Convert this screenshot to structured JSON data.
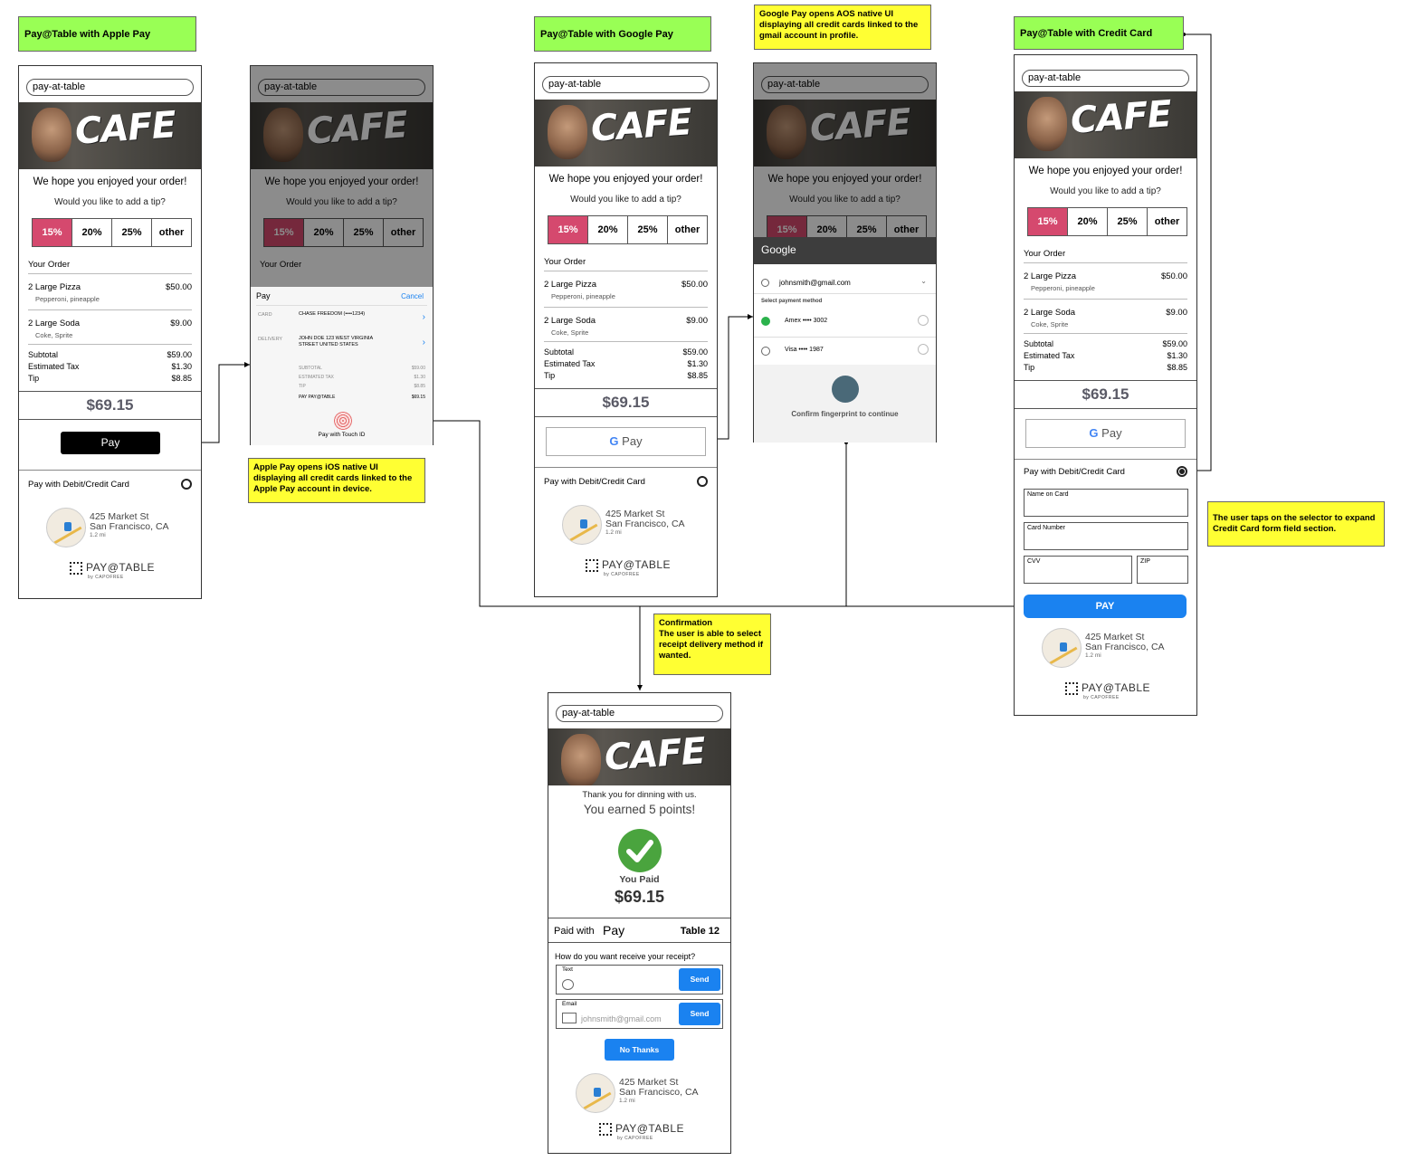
{
  "labels": {
    "apple": "Pay@Table with Apple Pay",
    "google": "Pay@Table with Google Pay",
    "credit": "Pay@Table with Credit Card"
  },
  "notes": {
    "apple": "Apple Pay opens iOS native UI displaying all credit cards linked to the Apple Pay account in device.",
    "google": "Google Pay opens AOS native UI displaying all credit cards linked to the gmail account in profile.",
    "credit": "The user taps on the selector to expand Credit Card form field section.",
    "confirm_title": "Confirmation",
    "confirm_body": "The user is able to select receipt delivery method if wanted."
  },
  "screen": {
    "url": "pay-at-table",
    "cafe": "CAFE",
    "thanks": "We hope you enjoyed your order!",
    "tip_q": "Would you like to add a tip?",
    "tips": [
      "15%",
      "20%",
      "25%",
      "other"
    ],
    "your_order": "Your Order",
    "items": [
      {
        "name": "2 Large Pizza",
        "desc": "Pepperoni, pineapple",
        "price": "$50.00"
      },
      {
        "name": "2 Large Soda",
        "desc": "Coke, Sprite",
        "price": "$9.00"
      }
    ],
    "subtotal_label": "Subtotal",
    "subtotal": "$59.00",
    "tax_label": "Estimated Tax",
    "tax": "$1.30",
    "tip_label": "Tip",
    "tip": "$8.85",
    "total": "$69.15",
    "apple_pay": " Pay",
    "google_pay": "Pay",
    "debit": "Pay with Debit/Credit Card",
    "addr1": "425 Market St",
    "addr2": "San Francisco, CA",
    "dist": "1.2 mi",
    "brand": "PAY@TABLE",
    "brand_sub": "by CAPOFREE"
  },
  "applesheet": {
    "title": " Pay",
    "cancel": "Cancel",
    "card_label": "CARD",
    "card_value": "CHASE FREEDOM (••••1234)",
    "delivery_label": "DELIVERY",
    "delivery_value": "JOHN DOE 123 WEST VIRGINIA STREET UNITED STATES",
    "subtotal": "SUBTOTAL",
    "subtotal_v": "$59.00",
    "tax": "ESTIMATED TAX",
    "tax_v": "$1.30",
    "tip": "TIP",
    "tip_v": "$8.85",
    "pay": "PAY PAY@TABLE",
    "pay_v": "$69.15",
    "touch": "Pay with Touch ID"
  },
  "googlesheet": {
    "title": "Google",
    "email": "johnsmith@gmail.com",
    "select": "Select payment method",
    "card1": "Amex •••• 3002",
    "card2": "Visa •••• 1987",
    "confirm": "Confirm fingerprint to continue"
  },
  "creditform": {
    "name": "Name on Card",
    "number": "Card Number",
    "cvv": "CVV",
    "zip": "ZIP",
    "pay": "PAY"
  },
  "confirmation": {
    "thanks": "Thank you for dinning with us.",
    "points": "You earned 5 points!",
    "you_paid": "You Paid",
    "amount": "$69.15",
    "paid_with": "Paid with",
    "paid_method": " Pay",
    "table": "Table 12",
    "receipt_q": "How do you want receive your receipt?",
    "text_label": "Text",
    "email_label": "Email",
    "email_value": "johnsmith@gmail.com",
    "send": "Send",
    "no_thanks": "No Thanks"
  }
}
